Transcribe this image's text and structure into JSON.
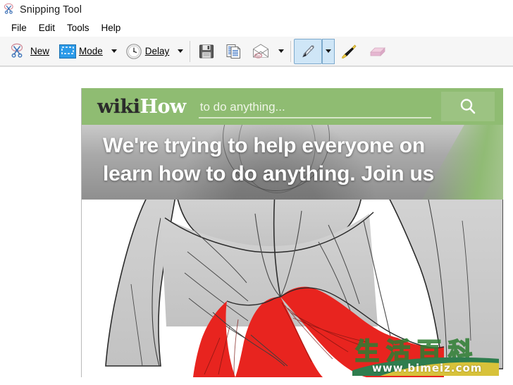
{
  "window": {
    "title": "Snipping Tool",
    "icon": "snipping-tool-scissors-icon"
  },
  "menubar": {
    "items": [
      {
        "label": "File"
      },
      {
        "label": "Edit"
      },
      {
        "label": "Tools"
      },
      {
        "label": "Help"
      }
    ]
  },
  "toolbar": {
    "new_label": "New",
    "new_icon": "scissors-icon",
    "mode_label": "Mode",
    "mode_icon": "rectangle-snip-icon",
    "mode_caret": "chevron-down-icon",
    "delay_label": "Delay",
    "delay_icon": "clock-icon",
    "delay_caret": "chevron-down-icon",
    "save_label": "Save Snip",
    "save_icon": "floppy-disk-icon",
    "copy_label": "Copy",
    "copy_icon": "copy-pages-icon",
    "email_label": "Send Snip",
    "email_icon": "envelope-icon",
    "email_caret": "chevron-down-icon",
    "pen_label": "Pen",
    "pen_icon": "pen-icon",
    "pen_caret": "chevron-down-icon",
    "pen_selected": true,
    "highlighter_label": "Highlighter",
    "highlighter_icon": "highlighter-icon",
    "eraser_label": "Eraser",
    "eraser_icon": "eraser-icon"
  },
  "snip": {
    "site": {
      "logo_wiki": "wiki",
      "logo_how": "How",
      "search_placeholder": "to do anything...",
      "search_value": "",
      "search_button_icon": "magnifier-icon"
    },
    "banner": {
      "line1": "We're trying to help everyone on",
      "line2": "learn how to do anything. Join us"
    },
    "illustration": {
      "name": "back-muscles-anatomy-illustration",
      "description": "Grey shaded drawing of a human back with the lower back muscles highlighted in red"
    },
    "watermark": {
      "characters": "生活百科",
      "url": "www.bimeiz.com"
    }
  },
  "colors": {
    "wikihow_green": "#8fbc72",
    "search_button_green": "#9cc382",
    "muscle_red": "#e8241f",
    "muscle_grey": "#c9c9c9",
    "toolbar_bg": "#f6f6f6",
    "selection_blue": "#cfe6f7",
    "watermark_green": "#2d7d32"
  }
}
